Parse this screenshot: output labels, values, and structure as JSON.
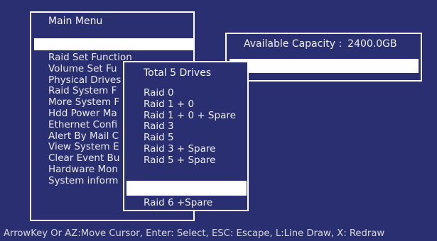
{
  "main_menu": {
    "title": "Main Menu",
    "items": [
      "Raid Set Function",
      "Volume Set Fu",
      "Physical Drives",
      "Raid System F",
      "More System F",
      "Hdd Power Ma",
      "Ethernet Confi",
      "Alert By Mail C",
      "View System E",
      "Clear Event Bu",
      "Hardware Mon",
      "System inform"
    ]
  },
  "raid_menu": {
    "title": "Total 5 Drives",
    "items": [
      "Raid 0",
      "Raid 1 + 0",
      "Raid 1 + 0 + Spare",
      "Raid 3",
      "Raid 5",
      "Raid 3 + Spare",
      "Raid 5 + Spare"
    ],
    "last_item": "Raid 6 +Spare"
  },
  "capacity": {
    "label": "Available Capacity :",
    "value": "2400.0GB"
  },
  "status_bar": {
    "text": "ArrowKey Or AZ:Move Cursor, Enter: Select, ESC: Escape, L:Line Draw, X: Redraw"
  },
  "colors": {
    "background": "#2a2f72",
    "foreground": "#ffffff",
    "highlight": "#ffffff"
  }
}
